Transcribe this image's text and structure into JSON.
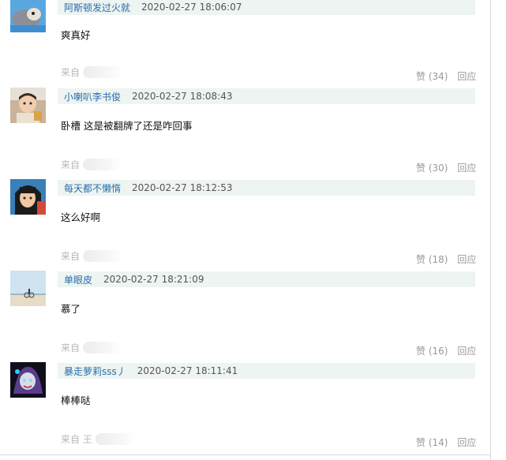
{
  "comments": [
    {
      "user": "阿斯顿发过火就",
      "time": "2020-02-27 18:06:07",
      "text": "爽真好",
      "from": "来自",
      "like": "赞",
      "likes": "(34)",
      "reply": "回应"
    },
    {
      "user": "小喇叭李书俊",
      "time": "2020-02-27 18:08:43",
      "text": "卧槽 这是被翻牌了还是咋回事",
      "from": "来自",
      "like": "赞",
      "likes": "(30)",
      "reply": "回应"
    },
    {
      "user": "每天都不懒惰",
      "time": "2020-02-27 18:12:53",
      "text": "这么好啊",
      "from": "来自",
      "like": "赞",
      "likes": "(18)",
      "reply": "回应"
    },
    {
      "user": "单眼皮",
      "time": "2020-02-27 18:21:09",
      "text": "慕了",
      "from": "来自",
      "like": "赞",
      "likes": "(16)",
      "reply": "回应"
    },
    {
      "user": "暴走萝莉sss丿",
      "time": "2020-02-27 18:11:41",
      "text": "棒棒哒",
      "from": "来自 王",
      "like": "赞",
      "likes": "(14)",
      "reply": "回应"
    }
  ]
}
